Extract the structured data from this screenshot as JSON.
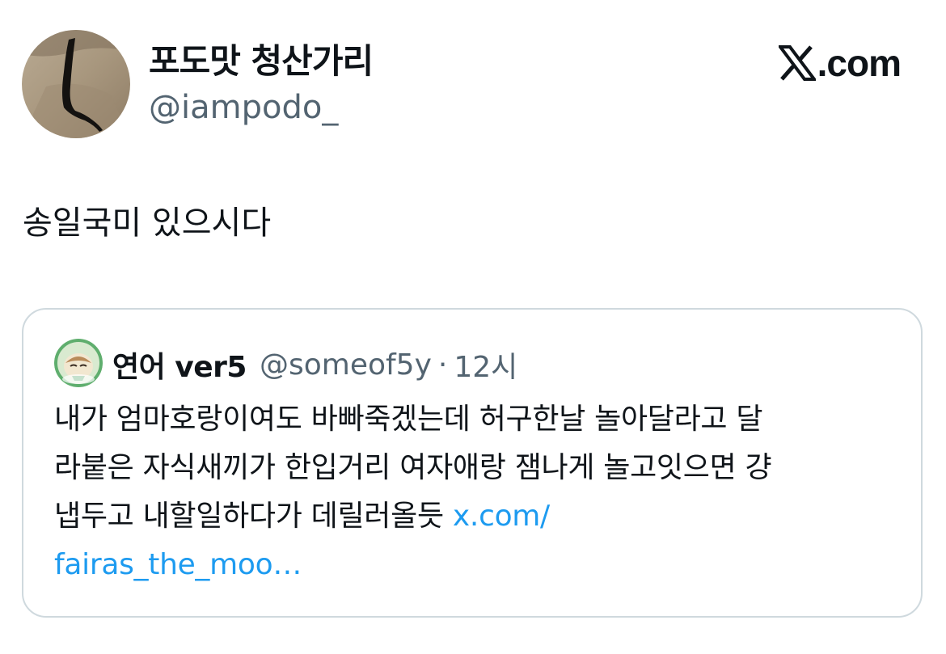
{
  "author": {
    "display_name": "포도맛 청산가리",
    "handle": "@iampodo_"
  },
  "brand": {
    "logo_icon": "x-logo-icon",
    "suffix": ".com"
  },
  "tweet": {
    "text": "송일국미 있으시다"
  },
  "quoted": {
    "display_name": "연어 ver5",
    "handle": "@someof5y",
    "separator": "·",
    "time": "12시",
    "lines": [
      "내가 엄마호랑이여도 바빠죽겠는데 허구한날 놀아달라고 달",
      "라붙은 자식새끼가 한입거리 여자애랑 잼나게 놀고잇으면 걍",
      "냅두고 내할일하다가 데릴러올듯 "
    ],
    "link_part1": "x.com/",
    "link_part2": "fairas_the_moo…"
  },
  "colors": {
    "text_primary": "#0f1419",
    "text_secondary": "#536471",
    "link": "#1d9bf0",
    "border": "#cfd9de"
  }
}
